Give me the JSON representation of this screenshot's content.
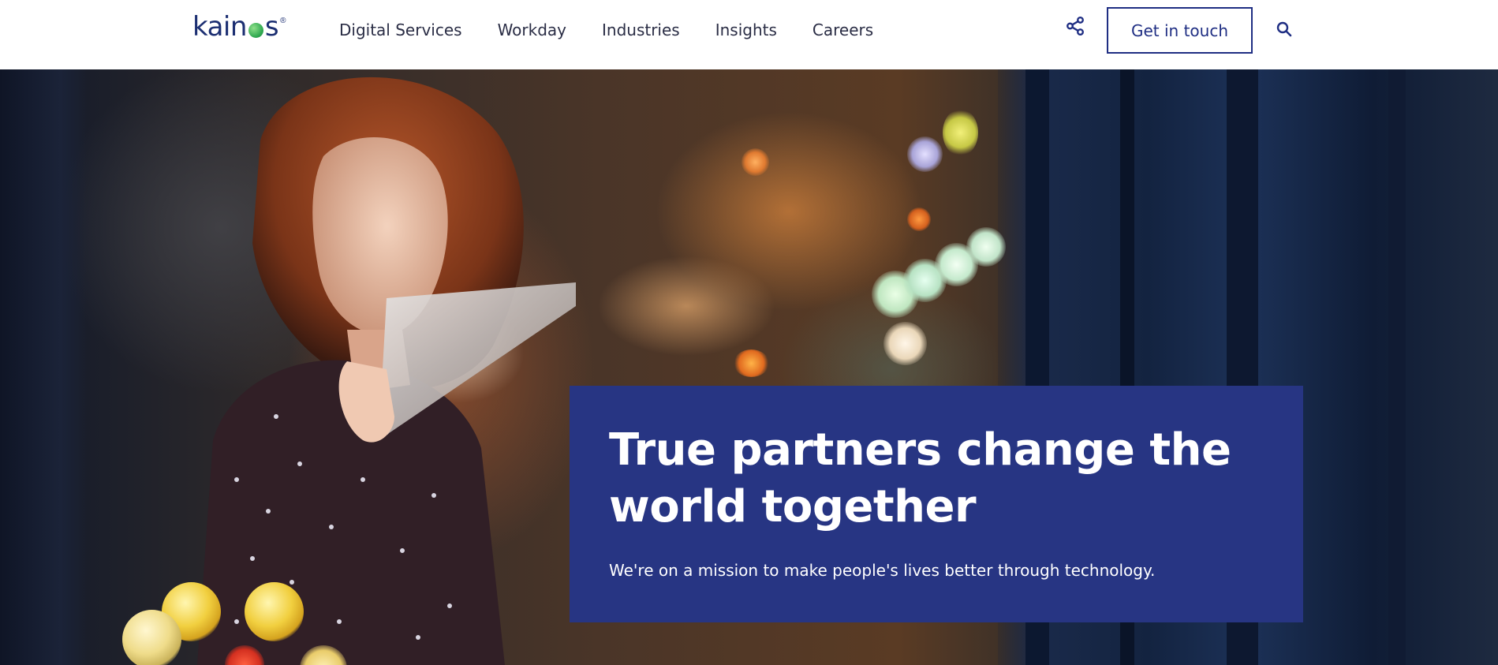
{
  "brand": {
    "logo_text_start": "kain",
    "logo_text_end": "s",
    "logo_reg": "®",
    "primary_color": "#1f2e83",
    "hero_card_color": "#273583",
    "logo_dot_color": "#2fa84f"
  },
  "nav": {
    "items": [
      {
        "label": "Digital Services"
      },
      {
        "label": "Workday"
      },
      {
        "label": "Industries"
      },
      {
        "label": "Insights"
      },
      {
        "label": "Careers"
      }
    ]
  },
  "header_actions": {
    "share_icon": "share-icon",
    "cta_label": "Get in touch",
    "search_icon": "search-icon"
  },
  "hero": {
    "title_line1": "True partners change the",
    "title_line2": "world together",
    "subtitle": "We're on a mission to make people's lives better through technology."
  }
}
